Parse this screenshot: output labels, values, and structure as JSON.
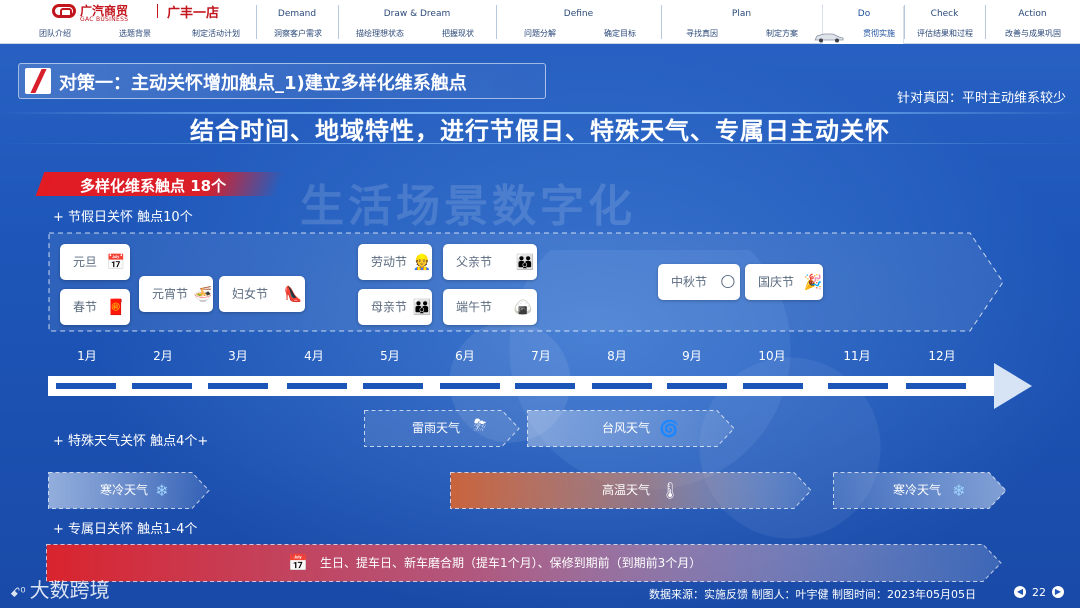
{
  "nav": {
    "brand_cn": "广汽商贸",
    "brand_en": "GAC BUSINESS",
    "store": "广丰一店",
    "phases": [
      "Demand",
      "Draw & Dream",
      "Define",
      "Plan",
      "Do",
      "Check",
      "Action"
    ],
    "steps": [
      "团队介绍",
      "选题背景",
      "制定活动计划",
      "洞察客户需求",
      "描绘理想状态",
      "把握现状",
      "问题分解",
      "确定目标",
      "寻找真因",
      "制定方案",
      "贯彻实施",
      "评估结果和过程",
      "改善与成果巩固"
    ],
    "active_phase": "Do",
    "active_step": "贯彻实施"
  },
  "header": {
    "title": "对策一：主动关怀增加触点_1)建立多样化维系触点",
    "root_cause": "针对真因：平时主动维系较少",
    "headline": "结合时间、地域特性，进行节假日、特殊天气、专属日主动关怀"
  },
  "section": {
    "tag": "多样化维系触点  18个",
    "watermark": "生活场景数字化"
  },
  "holiday": {
    "heading": "+ 节假日关怀  触点10个",
    "items": [
      {
        "label": "元旦",
        "icon": "calendar-icon",
        "glyph": "📅"
      },
      {
        "label": "春节",
        "icon": "spring-couplet-icon",
        "glyph": "🧧"
      },
      {
        "label": "元宵节",
        "icon": "rice-ball-bowl-icon",
        "glyph": "🍜"
      },
      {
        "label": "妇女节",
        "icon": "high-heel-icon",
        "glyph": "👠"
      },
      {
        "label": "劳动节",
        "icon": "worker-icon",
        "glyph": "👷"
      },
      {
        "label": "母亲节",
        "icon": "family-icon",
        "glyph": "👪"
      },
      {
        "label": "父亲节",
        "icon": "family-icon",
        "glyph": "👪"
      },
      {
        "label": "端午节",
        "icon": "zongzi-icon",
        "glyph": "🍙"
      },
      {
        "label": "中秋节",
        "icon": "moon-icon",
        "glyph": "🌕"
      },
      {
        "label": "国庆节",
        "icon": "firework-icon",
        "glyph": "🎉"
      }
    ]
  },
  "months": [
    "1月",
    "2月",
    "3月",
    "4月",
    "5月",
    "6月",
    "7月",
    "8月",
    "9月",
    "10月",
    "11月",
    "12月"
  ],
  "weather": {
    "heading": "+ 特殊天气关怀  触点4个+",
    "items": [
      {
        "label": "雷雨天气",
        "icon": "thunderstorm-icon",
        "glyph": "⛈"
      },
      {
        "label": "台风天气",
        "icon": "typhoon-icon",
        "glyph": "🌀"
      },
      {
        "label": "寒冷天气",
        "icon": "snowflake-icon",
        "glyph": "❄"
      },
      {
        "label": "高温天气",
        "icon": "thermometer-icon",
        "glyph": "🌡"
      },
      {
        "label": "寒冷天气",
        "icon": "snowflake-icon",
        "glyph": "❄"
      }
    ]
  },
  "exclusive": {
    "heading": "+ 专属日关怀  触点1-4个",
    "text": "生日、提车日、新车磨合期（提车1个月）、保修到期前（到期前3个月）",
    "icon": "calendar-icon",
    "glyph": "📅"
  },
  "footer": {
    "logo": "大数跨境",
    "logo_mark": "ꗃ⁰",
    "meta": "数据来源：实施反馈   制图人：叶宇健   制图时间：2023年05月05日",
    "page": "22",
    "prev": "◀",
    "next": "▶"
  },
  "colors": {
    "brand_red": "#c2151d",
    "accent_red": "#e31b23",
    "background_blue": "#1d56b8",
    "hot_orange": "#d86a3a"
  }
}
